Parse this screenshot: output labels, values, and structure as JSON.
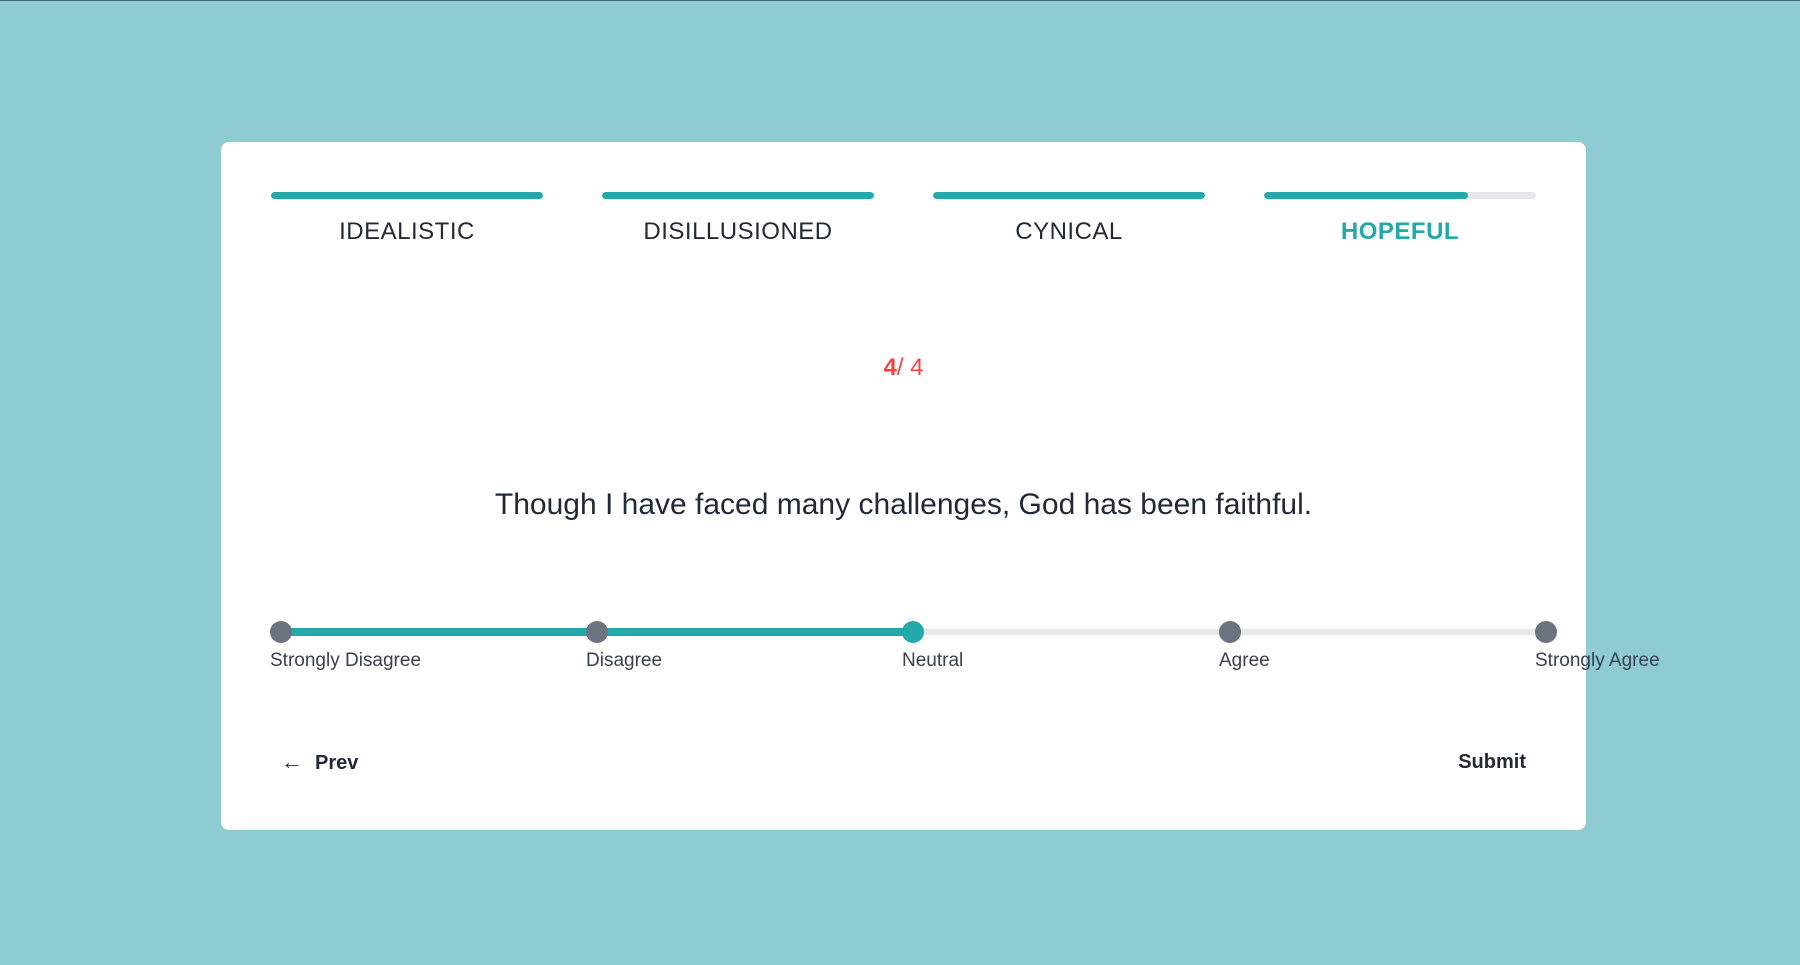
{
  "colors": {
    "background": "#8fcbd3",
    "accent": "#23a9ab",
    "counter": "#ef4444",
    "inactive_dot": "#6b7280",
    "track": "#e5e7eb"
  },
  "steps": [
    {
      "label": "IDEALISTIC",
      "progress": 1.0,
      "active": false
    },
    {
      "label": "DISILLUSIONED",
      "progress": 1.0,
      "active": false
    },
    {
      "label": "CYNICAL",
      "progress": 1.0,
      "active": false
    },
    {
      "label": "HOPEFUL",
      "progress": 0.75,
      "active": true
    }
  ],
  "counter": {
    "current": "4",
    "separator_total": "/ 4"
  },
  "question": {
    "text": "Though I have faced many challenges, God has been faithful."
  },
  "scale": {
    "options": [
      {
        "label": "Strongly Disagree"
      },
      {
        "label": "Disagree"
      },
      {
        "label": "Neutral"
      },
      {
        "label": "Agree"
      },
      {
        "label": "Strongly Agree"
      }
    ],
    "selected_index": 2
  },
  "nav": {
    "prev_icon": "arrow-left-icon",
    "prev_label": "Prev",
    "submit_label": "Submit"
  }
}
